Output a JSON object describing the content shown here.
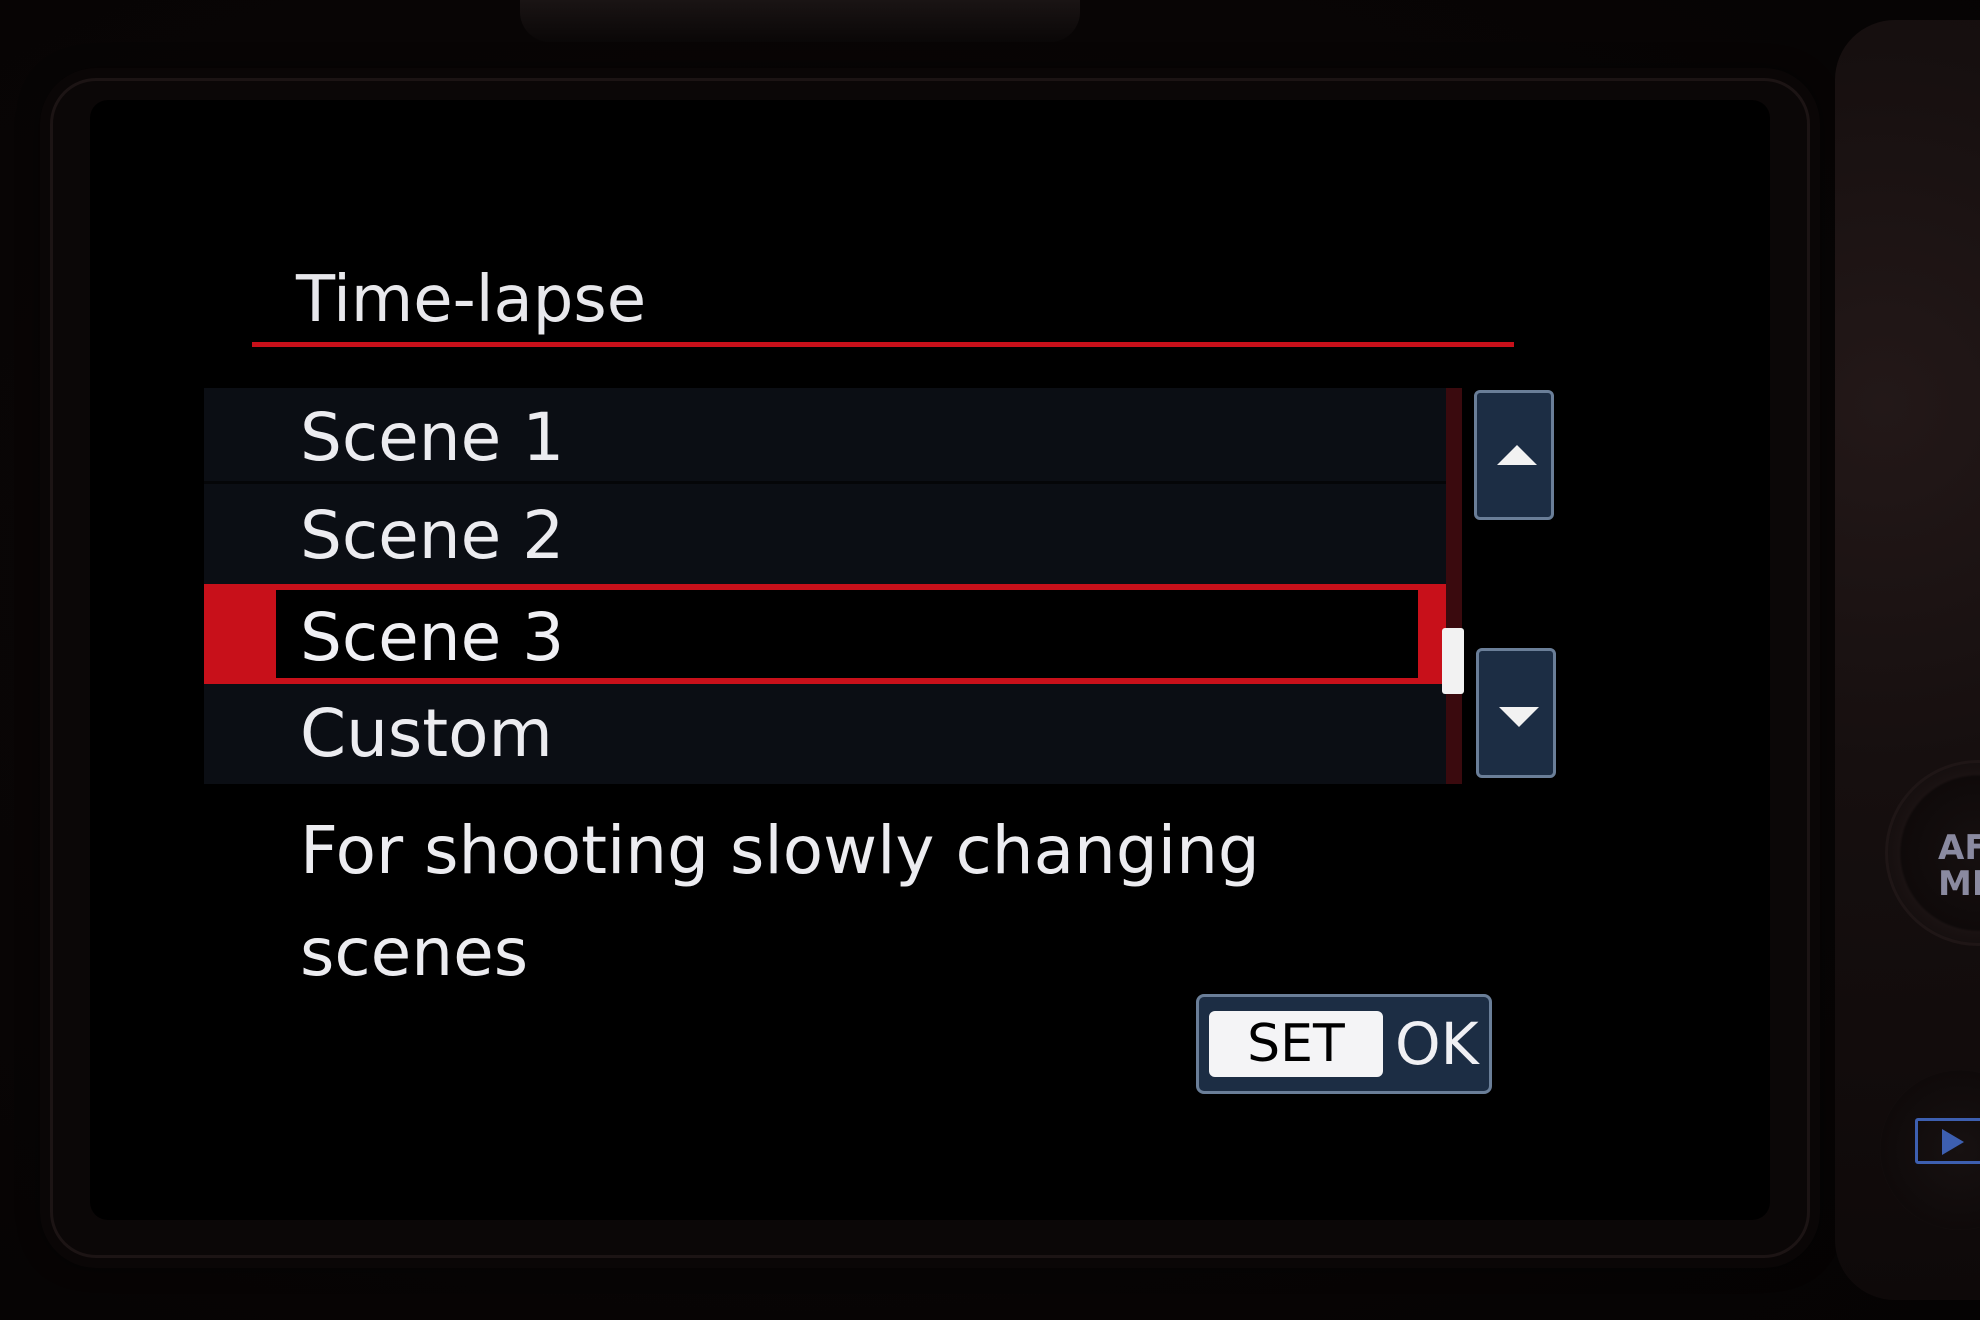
{
  "screen": {
    "title": "Time-lapse",
    "menu_items": [
      {
        "label": "Scene 1",
        "selected": false
      },
      {
        "label": "Scene 2",
        "selected": false
      },
      {
        "label": "Scene 3",
        "selected": true
      },
      {
        "label": "Custom",
        "selected": false
      }
    ],
    "description_line1": "For shooting slowly changing",
    "description_line2": "scenes",
    "set_button": {
      "key": "SET",
      "action": "OK"
    }
  },
  "camera": {
    "dial_label": "AF MF"
  },
  "colors": {
    "accent": "#c8101a",
    "button_bg": "#1c2d44",
    "button_border": "#6a7e98",
    "text": "#ececf0"
  },
  "icons": [
    "up-arrow-icon",
    "down-arrow-icon",
    "playback-icon"
  ]
}
